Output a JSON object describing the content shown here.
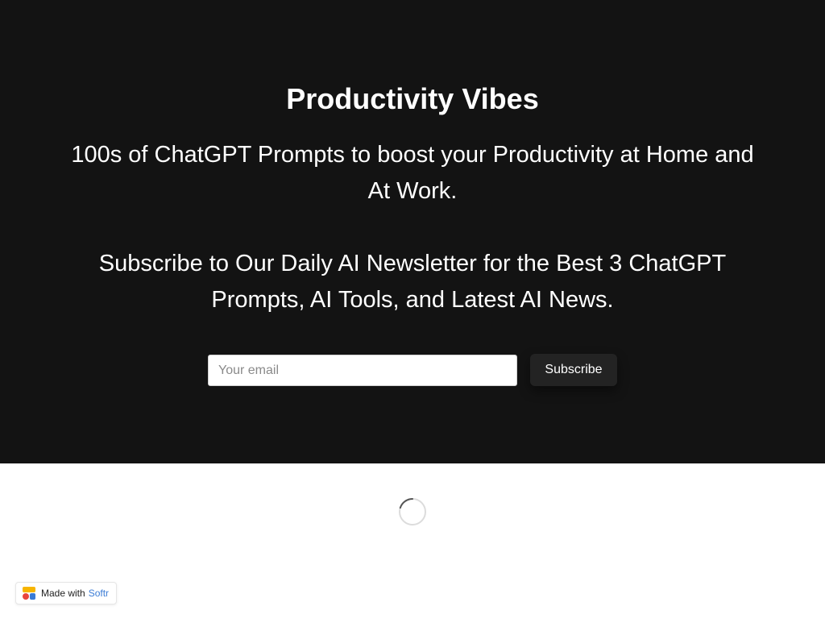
{
  "hero": {
    "title": "Productivity Vibes",
    "description_1": "100s of ChatGPT Prompts to boost your Productivity at Home and At Work.",
    "description_2": "Subscribe to Our Daily AI Newsletter for the Best 3 ChatGPT Prompts, AI Tools, and Latest AI News."
  },
  "subscribe_form": {
    "email_placeholder": "Your email",
    "email_value": "",
    "button_label": "Subscribe"
  },
  "loading": {
    "icon": "loading-spinner-icon"
  },
  "badge": {
    "made_with_label": "Made with",
    "brand_label": "Softr",
    "logo_icon": "softr-logo-icon"
  },
  "colors": {
    "hero_background": "#131313",
    "button_background": "#232323",
    "brand_accent": "#3a7bd5"
  }
}
